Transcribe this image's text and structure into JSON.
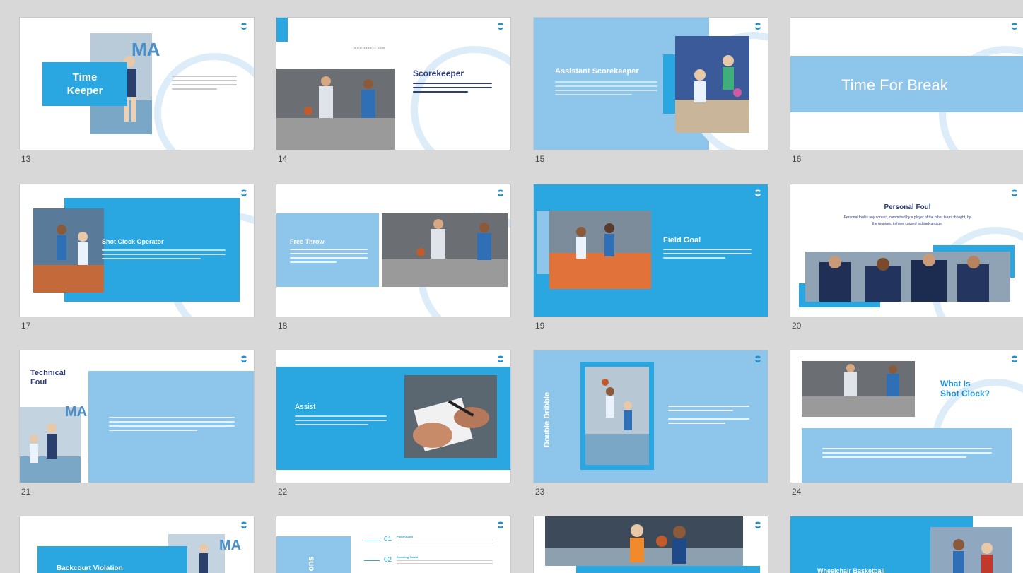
{
  "colors": {
    "accent": "#2aa7e0",
    "light_accent": "#8ec5ea",
    "navy": "#2d3d7a",
    "bg": "#d8d8d8"
  },
  "slides": [
    {
      "number": "13",
      "title_l1": "Time",
      "title_l2": "Keeper",
      "overlay": "MA"
    },
    {
      "number": "14",
      "title": "Scorekeeper",
      "body": "These' are scorekeeper whose job is to keep track of and record ahead of each. In which the course... [not legible]",
      "caption": "www.ssssss.com"
    },
    {
      "number": "15",
      "title": "Assistant Scorekeeper"
    },
    {
      "number": "16",
      "title": "Time For Break"
    },
    {
      "number": "17",
      "title": "Shot Clock Operator"
    },
    {
      "number": "18",
      "title": "Free Throw"
    },
    {
      "number": "19",
      "title": "Field Goal"
    },
    {
      "number": "20",
      "title": "Personal Foul",
      "body_l1": "Personal foul is any contact, committed by a player of the other team, thought, by",
      "body_l2": "the umpires, to have caused a disadvantage."
    },
    {
      "number": "21",
      "title_l1": "Technical",
      "title_l2": "Foul",
      "overlay": "MA"
    },
    {
      "number": "22",
      "title": "Assist"
    },
    {
      "number": "23",
      "title": "Double Dribble"
    },
    {
      "number": "24",
      "title_l1": "What Is",
      "title_l2": "Shot Clock?"
    },
    {
      "number": "",
      "title": "Backcourt Violation",
      "overlay": "MA"
    },
    {
      "number": "",
      "title": "ons",
      "item1_num": "01",
      "item2_num": "02",
      "item1_label": "Point Guard",
      "item2_label": "Shooting Guard"
    },
    {
      "number": ""
    },
    {
      "number": "",
      "title": "Wheelchair Basketball"
    }
  ]
}
